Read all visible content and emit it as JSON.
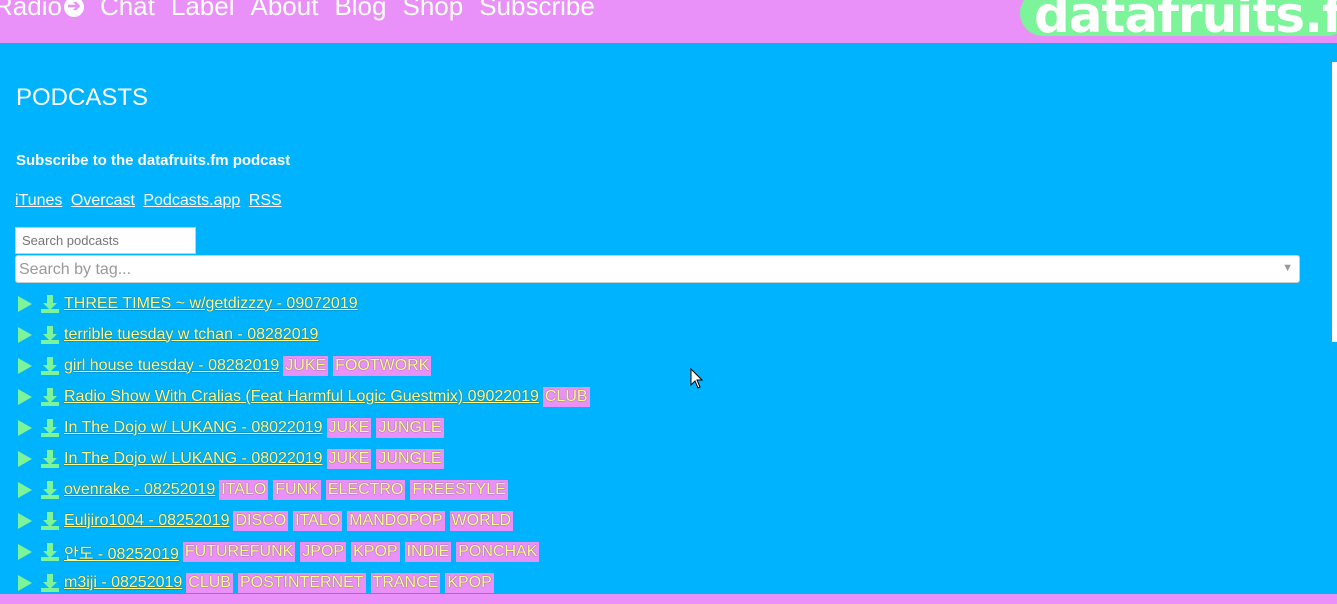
{
  "nav": {
    "radio": "Radio",
    "radio_arrow": "➔",
    "chat": "Chat",
    "label": "Label",
    "about": "About",
    "blog": "Blog",
    "shop": "Shop",
    "subscribe": "Subscribe"
  },
  "logo": {
    "text": "datafruits.fm"
  },
  "page": {
    "title": "PODCASTS",
    "subscribe_text": "Subscribe to the datafruits.fm podcast",
    "links": {
      "itunes": "iTunes",
      "overcast": "Overcast",
      "podcasts_app": "Podcasts.app",
      "rss": "RSS"
    },
    "search_placeholder": "Search podcasts",
    "tag_placeholder": "Search by tag..."
  },
  "podcasts": [
    {
      "title": "THREE TIMES ~ w/getdizzzy - 09072019",
      "tags": []
    },
    {
      "title": "terrible tuesday w tchan - 08282019",
      "tags": []
    },
    {
      "title": "girl house tuesday - 08282019",
      "tags": [
        "JUKE",
        "FOOTWORK"
      ]
    },
    {
      "title": "Radio Show With Cralias (Feat Harmful Logic Guestmix) 09022019",
      "tags": [
        "CLUB"
      ]
    },
    {
      "title": "In The Dojo w/ LUKANG - 08022019",
      "tags": [
        "JUKE",
        "JUNGLE"
      ]
    },
    {
      "title": "In The Dojo w/ LUKANG - 08022019",
      "tags": [
        "JUKE",
        "JUNGLE"
      ]
    },
    {
      "title": "ovenrake - 08252019",
      "tags": [
        "ITALO",
        "FUNK",
        "ELECTRO",
        "FREESTYLE"
      ]
    },
    {
      "title": "Euljiro1004 - 08252019",
      "tags": [
        "DISCO",
        "ITALO",
        "MANDOPOP",
        "WORLD"
      ]
    },
    {
      "title": "안도 - 08252019",
      "tags": [
        "FUTUREFUNK",
        "JPOP",
        "KPOP",
        "INDIE",
        "PONCHAK"
      ]
    },
    {
      "title": "m3iji - 08252019",
      "tags": [
        "CLUB",
        "POSTINTERNET",
        "TRANCE",
        "KPOP"
      ]
    }
  ],
  "colors": {
    "background": "#00b3ff",
    "pink": "#e991f8",
    "green": "#7cf59a",
    "yellow": "#ffff8a"
  }
}
